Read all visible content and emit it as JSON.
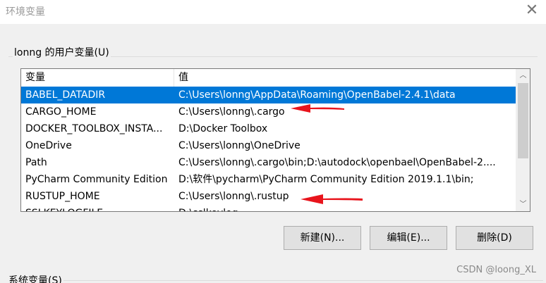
{
  "window": {
    "title": "环境变量"
  },
  "user_vars": {
    "group_label": "lonng 的用户变量(U)",
    "columns": [
      "变量",
      "值"
    ],
    "rows": [
      {
        "name": "BABEL_DATADIR",
        "value": "C:\\Users\\lonng\\AppData\\Roaming\\OpenBabel-2.4.1\\data",
        "selected": true
      },
      {
        "name": "CARGO_HOME",
        "value": "C:\\Users\\lonng\\.cargo",
        "selected": false
      },
      {
        "name": "DOCKER_TOOLBOX_INSTA...",
        "value": "D:\\Docker Toolbox",
        "selected": false
      },
      {
        "name": "OneDrive",
        "value": "C:\\Users\\lonng\\OneDrive",
        "selected": false
      },
      {
        "name": "Path",
        "value": "C:\\Users\\lonng\\.cargo\\bin;D:\\autodock\\openbael\\OpenBabel-2....",
        "selected": false
      },
      {
        "name": "PyCharm Community Edition",
        "value": "D:\\软件\\pycharm\\PyCharm Community Edition 2019.1.1\\bin;",
        "selected": false
      },
      {
        "name": "RUSTUP_HOME",
        "value": "C:\\Users\\lonng\\.rustup",
        "selected": false
      },
      {
        "name": "SSLKEYLOGFILE",
        "value": "D:\\sslkeylog",
        "selected": false
      }
    ],
    "buttons": {
      "new": "新建(N)...",
      "edit": "编辑(E)...",
      "delete": "删除(D)"
    }
  },
  "system_vars": {
    "group_label": "系统变量(S)"
  },
  "annotations": {
    "arrow_color": "#e8141c"
  },
  "watermark": "CSDN @loong_XL"
}
